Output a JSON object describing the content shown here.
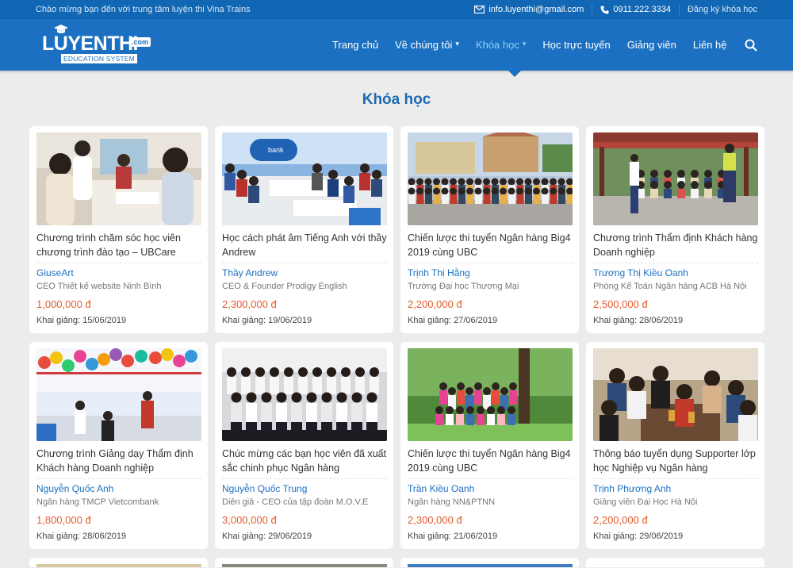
{
  "topbar": {
    "welcome": "Chào mừng bạn đến với trung tâm luyện thi Vina Trains",
    "email": "info.luyenthi@gmail.com",
    "phone": "0911.222.3334",
    "register": "Đăng ký khóa học"
  },
  "logo": {
    "word": "LUYENTHI",
    "com": ".com",
    "sub": "EDUCATION SYSTEM"
  },
  "nav": {
    "items": [
      {
        "label": "Trang chủ"
      },
      {
        "label": "Về chúng tôi"
      },
      {
        "label": "Khóa học"
      },
      {
        "label": "Học trực tuyến"
      },
      {
        "label": "Giảng viên"
      },
      {
        "label": "Liên hệ"
      }
    ]
  },
  "section_title": "Khóa học",
  "courses": [
    {
      "title": "Chương trình chăm sóc học viên chương trình đào tạo – UBCare",
      "author": "GiuseArt",
      "role": "CEO Thiết kế website Ninh Bình",
      "price": "1,000,000 đ",
      "start": "Khai giảng: 15/06/2019",
      "img": "office"
    },
    {
      "title": "Học cách phát âm Tiếng Anh với thầy Andrew",
      "author": "Thầy Andrew",
      "role": "CEO & Founder Prodigy English",
      "price": "2,300,000 đ",
      "start": "Khai giảng: 19/06/2019",
      "img": "classroom"
    },
    {
      "title": "Chiến lược thi tuyển Ngân hàng Big4 2019 cùng UBC",
      "author": "Trịnh Thị Hằng",
      "role": "Trường Đại học Thương Mại",
      "price": "2,200,000 đ",
      "start": "Khai giảng: 27/06/2019",
      "img": "crowd"
    },
    {
      "title": "Chương trình Thẩm định Khách hàng Doanh nghiệp",
      "author": "Trương Thị Kiều Oanh",
      "role": "Phòng Kế Toán Ngân hàng ACB Hà Nội",
      "price": "2,500,000 đ",
      "start": "Khai giảng: 28/06/2019",
      "img": "pavilion"
    },
    {
      "title": "Chương trình Giảng dạy Thẩm định Khách hàng Doanh nghiệp",
      "author": "Nguyễn Quốc Anh",
      "role": "Ngân hàng TMCP Vietcombank",
      "price": "1,800,000 đ",
      "start": "Khai giảng: 28/06/2019",
      "img": "balloons"
    },
    {
      "title": "Chúc mừng các bạn học viên đã xuất sắc chinh phục Ngân hàng",
      "author": "Nguyễn Quốc Trung",
      "role": "Diễn giả - CEO của tập đoàn M.O.V.E",
      "price": "3,000,000 đ",
      "start": "Khai giảng: 29/06/2019",
      "img": "graduates"
    },
    {
      "title": "Chiến lược thi tuyển Ngân hàng Big4 2019 cùng UBC",
      "author": "Trần Kiều Oanh",
      "role": "Ngân hàng NN&PTNN",
      "price": "2,300,000 đ",
      "start": "Khai giảng: 21/06/2019",
      "img": "park"
    },
    {
      "title": "Thông báo tuyển dụng Supporter lớp học Nghiệp vụ Ngân hàng",
      "author": "Trịnh Phương Anh",
      "role": "Giảng viên Đại Học Hà Nội",
      "price": "2,200,000 đ",
      "start": "Khai giảng: 29/06/2019",
      "img": "party"
    }
  ],
  "colors": {
    "brand": "#1c70c1",
    "topbar": "#1267b5",
    "price": "#e55a2b",
    "active_nav": "#8fd0f7",
    "title": "#1d6ab3"
  },
  "icons": {
    "email": "envelope-icon",
    "phone": "phone-icon",
    "search": "search-icon",
    "dropdown": "chevron-down-icon"
  }
}
